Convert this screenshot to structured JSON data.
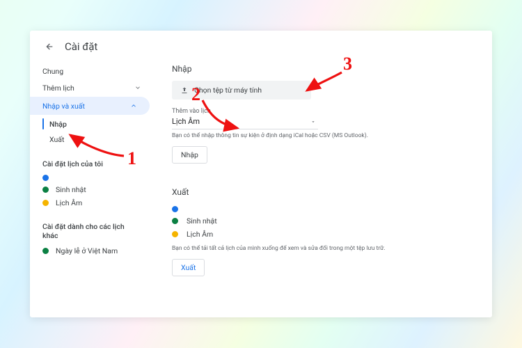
{
  "header": {
    "title": "Cài đặt"
  },
  "sidebar": {
    "general": "Chung",
    "addCalendar": "Thêm lịch",
    "importExport": "Nhập và xuất",
    "subImport": "Nhập",
    "subExport": "Xuất",
    "myCalsHeading": "Cài đặt lịch của tôi",
    "myCals": [
      {
        "label": "",
        "color": "#1a73e8"
      },
      {
        "label": "Sinh nhật",
        "color": "#0b8043"
      },
      {
        "label": "Lịch Âm",
        "color": "#f5b400"
      }
    ],
    "otherCalsHeading": "Cài đặt dành cho các lịch khác",
    "otherCals": [
      {
        "label": "Ngày lễ ở Việt Nam",
        "color": "#0b8043"
      }
    ]
  },
  "main": {
    "importTitle": "Nhập",
    "fileBtn": "Chọn tệp từ máy tính",
    "addToCalLabel": "Thêm vào lịch",
    "addToCalValue": "Lịch Âm",
    "importHelper": "Bạn có thể nhập thông tin sự kiện ở định dạng iCal hoặc CSV (MS Outlook).",
    "importBtn": "Nhập",
    "exportTitle": "Xuất",
    "exportCals": [
      {
        "label": "",
        "color": "#1a73e8"
      },
      {
        "label": "Sinh nhật",
        "color": "#0b8043"
      },
      {
        "label": "Lịch Âm",
        "color": "#f5b400"
      }
    ],
    "exportHelper": "Bạn có thể tải tất cả lịch của mình xuống để xem và sửa đổi trong một tệp lưu trữ.",
    "exportBtn": "Xuất"
  },
  "annotations": {
    "one": "1",
    "two": "2",
    "three": "3"
  }
}
